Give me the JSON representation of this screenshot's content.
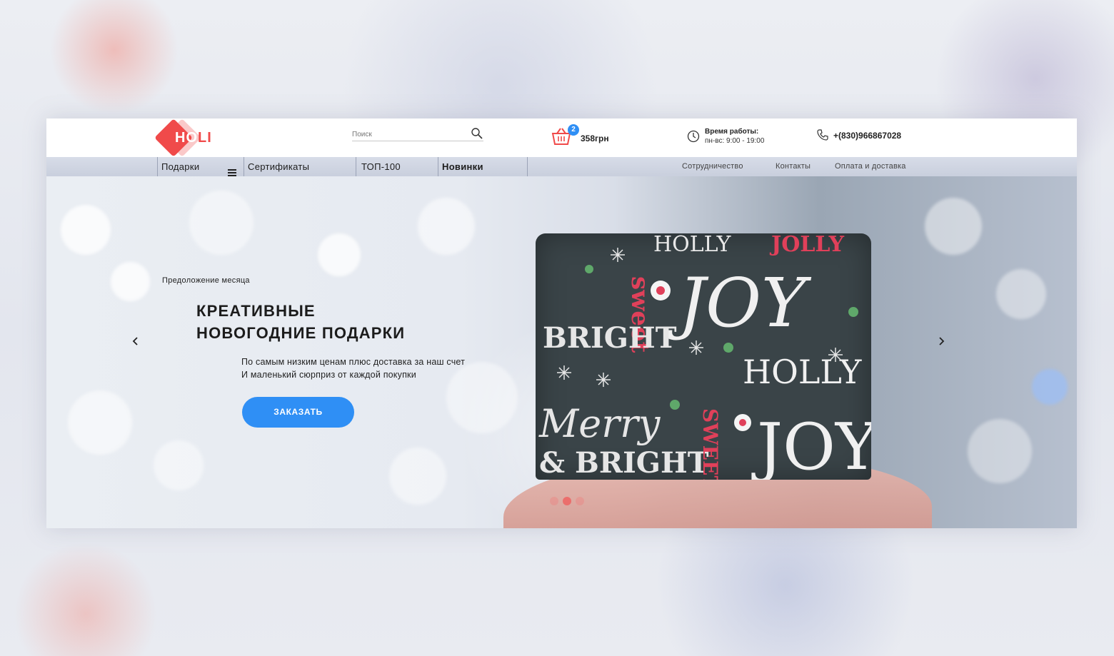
{
  "brand": {
    "logo_text_a": "HO",
    "logo_text_b": "LI",
    "accent": "#f04a4a",
    "primary": "#2f8ff5"
  },
  "header": {
    "search_placeholder": "Поиск",
    "cart": {
      "count": "2",
      "amount": "358грн"
    },
    "hours": {
      "title": "Время работы:",
      "value": "пн-вс: 9:00 - 19:00"
    },
    "phone": "+(830)966867028"
  },
  "nav": {
    "items": [
      "Подарки",
      "Сертификаты",
      "ТОП-100",
      "Новинки"
    ],
    "links": [
      "Сотрудничество",
      "Контакты",
      "Оплата и доставка"
    ]
  },
  "hero": {
    "offer": "Предоложение  месяца",
    "headline_line1": "КРЕАТИВНЫЕ",
    "headline_line2": "НОВОГОДНИЕ ПОДАРКИ",
    "desc_line1": "По самым низким ценам плюс доставка за наш счет",
    "desc_line2": "И маленький сюрприз от каждой покупки",
    "cta": "ЗАКАЗАТЬ",
    "gift_words": [
      "HOLLY",
      "JOLLY",
      "JOY",
      "HOLLY",
      "sweet",
      "Merry",
      "& BRIGHT",
      "BRIGHT",
      "SWEET",
      "JOY"
    ],
    "slides": 3,
    "active_slide": 2
  },
  "icons": [
    "search-icon",
    "basket-icon",
    "clock-icon",
    "phone-icon",
    "menu-icon",
    "chevron-left-icon",
    "chevron-right-icon"
  ]
}
